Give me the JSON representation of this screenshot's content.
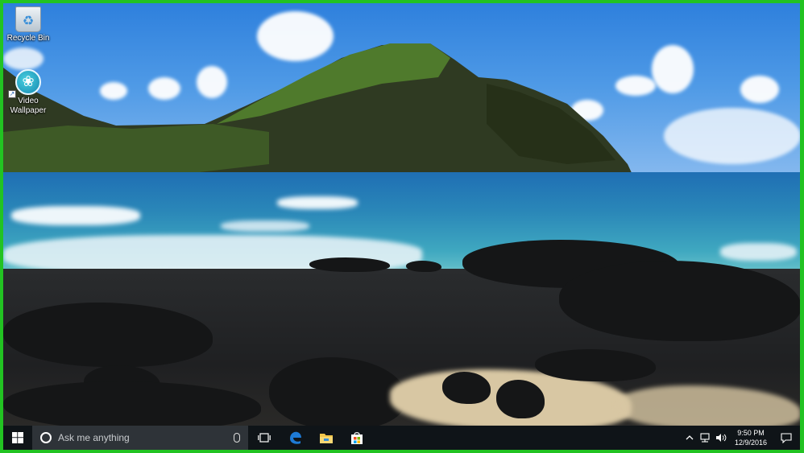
{
  "desktop": {
    "icons": [
      {
        "label": "Recycle Bin",
        "icon": "recycle-bin-icon"
      },
      {
        "label": "Video\nWallpaper",
        "icon": "video-wallpaper-icon"
      }
    ]
  },
  "taskbar": {
    "start_icon": "windows-logo-icon",
    "search": {
      "placeholder": "Ask me anything",
      "icon": "cortana-circle-icon",
      "mic_icon": "microphone-icon"
    },
    "task_view_icon": "task-view-icon",
    "pinned": [
      {
        "app": "edge-browser-icon"
      },
      {
        "app": "file-explorer-icon"
      },
      {
        "app": "store-icon"
      }
    ],
    "tray": {
      "chevron_icon": "chevron-up-icon",
      "network_icon": "network-icon",
      "volume_icon": "volume-icon",
      "time": "9:50 PM",
      "date": "12/9/2016",
      "notification_icon": "action-center-icon"
    }
  },
  "colors": {
    "frame_border": "#22c322",
    "taskbar": "#0f1418",
    "search_box": "#2e3338",
    "edge_blue": "#1e7bd6"
  }
}
